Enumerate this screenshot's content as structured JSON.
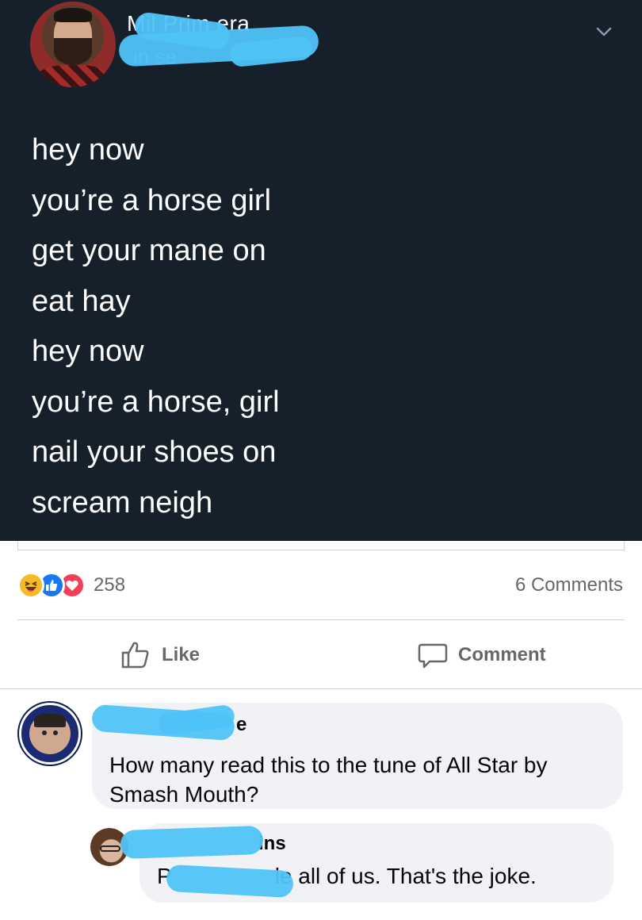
{
  "tweet": {
    "name_visible": "Mil   Prim   era",
    "handle_visible": "   in    se",
    "lines": [
      "hey now",
      "you’re a horse girl",
      "get your mane on",
      "eat hay",
      "hey now",
      "you’re a horse, girl",
      "nail your shoes on",
      "scream neigh"
    ]
  },
  "post_stats": {
    "reaction_count": "258",
    "comments_label": "6 Comments",
    "reactions": [
      "haha-icon",
      "like-icon",
      "love-icon"
    ]
  },
  "actions": {
    "like_label": "Like",
    "comment_label": "Comment"
  },
  "comments": [
    {
      "author_visible": "e",
      "text": "How many read this to the tune of All Star by Smash Mouth?"
    },
    {
      "author_visible": "ins",
      "text_visible_start": "P",
      "text_visible_end": "le all of us. That's the joke."
    }
  ],
  "colors": {
    "tweet_bg": "#15202b",
    "redaction": "#4fc3f7",
    "like_blue": "#1877f2",
    "love_red": "#f33e58",
    "haha_yellow": "#f7b928",
    "bubble_bg": "#f0f2f5",
    "muted_text": "#65676b"
  }
}
